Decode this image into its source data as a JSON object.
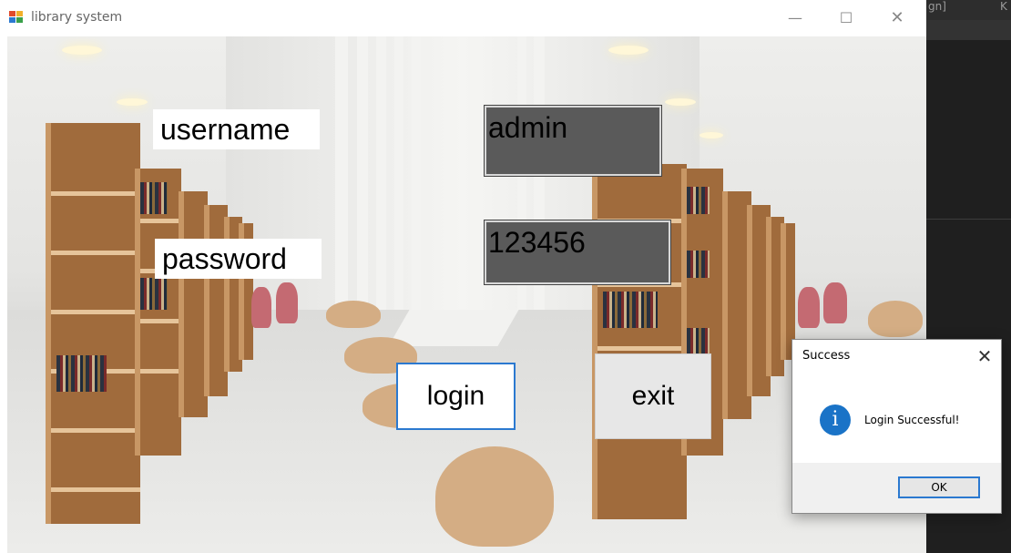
{
  "ide": {
    "tab_left": "gn]",
    "tab_right": "K"
  },
  "window": {
    "title": "library system",
    "minimize_glyph": "—",
    "maximize_glyph": "☐",
    "close_glyph": "✕"
  },
  "form": {
    "username_label": "username",
    "password_label": "password",
    "username_value": "admin",
    "password_value": "123456",
    "login_label": "login",
    "exit_label": "exit"
  },
  "dialog": {
    "title": "Success",
    "close_glyph": "✕",
    "icon_glyph": "i",
    "message": "Login Successful!",
    "ok_label": "OK",
    "icon": "info-icon"
  },
  "colors": {
    "accent": "#2b79d0",
    "field_bg": "#5a5a5a",
    "info_icon": "#1a73c7"
  }
}
